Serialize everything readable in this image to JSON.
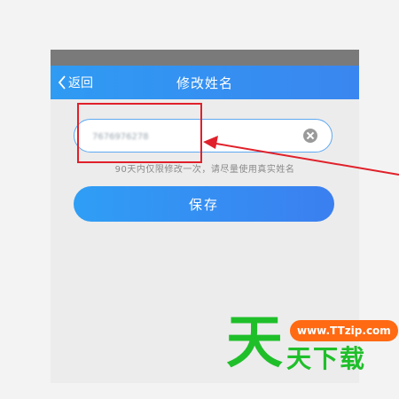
{
  "nav": {
    "back_label": "返回",
    "title": "修改姓名"
  },
  "name_input": {
    "value": "7676976278"
  },
  "hint_text": "90天内仅限修改一次，请尽量使用真实姓名",
  "save_button": {
    "label": "保存"
  },
  "annotation": {
    "highlight_color": "#e0202a"
  },
  "watermark": {
    "big_char": "天",
    "url": "www.TTzip.com",
    "text": "天下载"
  },
  "colors": {
    "nav_bar": "#3a8ff2",
    "input_border": "#5da9f2",
    "save_button": "#3b8df2",
    "watermark_green": "#1fbf2a",
    "watermark_orange": "#ff6a13"
  }
}
